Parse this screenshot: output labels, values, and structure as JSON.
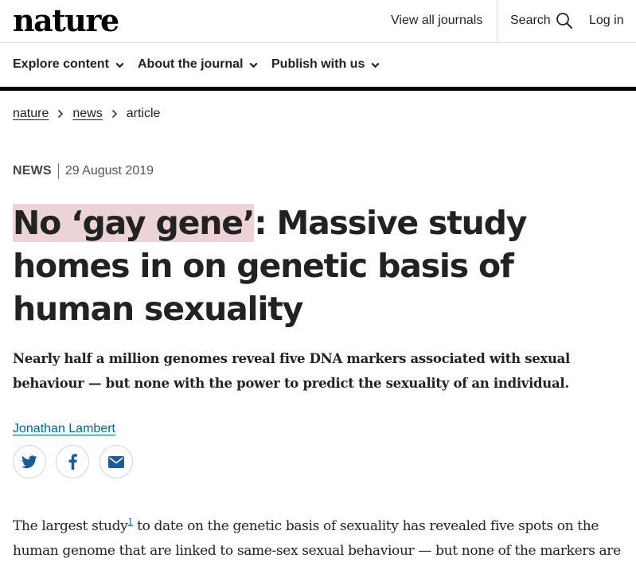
{
  "header": {
    "logo": "nature",
    "view_all_journals": "View all journals",
    "search_label": "Search",
    "login_label": "Log in"
  },
  "nav": {
    "items": [
      {
        "label": "Explore content"
      },
      {
        "label": "About the journal"
      },
      {
        "label": "Publish with us"
      }
    ]
  },
  "breadcrumb": {
    "items": [
      "nature",
      "news"
    ],
    "current": "article"
  },
  "article": {
    "type": "NEWS",
    "date": "29 August 2019",
    "title_highlight": "No ‘gay gene’",
    "title_rest": ": Massive study homes in on genetic basis of human sexuality",
    "standfirst": "Nearly half a million genomes reveal five DNA markers associated with sexual behaviour — but none with the power to predict the sexuality of an individual.",
    "author": "Jonathan Lambert",
    "share": [
      {
        "icon": "twitter-icon",
        "color": "#1c6eb0"
      },
      {
        "icon": "facebook-icon",
        "color": "#1c5a9e"
      },
      {
        "icon": "email-icon",
        "color": "#1c5a9e"
      }
    ],
    "body_before_ref": "The largest study",
    "body_ref": "1",
    "body_after_ref": " to date on the genetic basis of sexuality has revealed five spots on the human genome that are linked to same-sex sexual behaviour — but none of the markers are reliable"
  },
  "colors": {
    "highlight": "#ecd3d8",
    "link": "#006699",
    "nav_rule": "#000000"
  }
}
